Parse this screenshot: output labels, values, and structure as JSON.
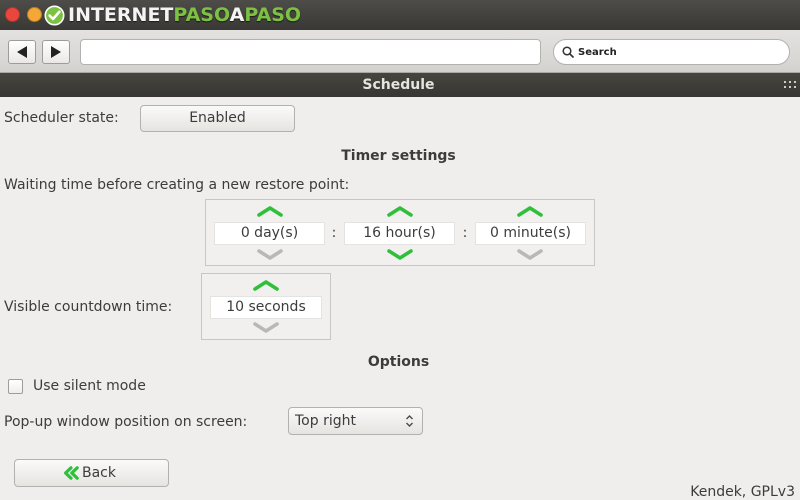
{
  "colors": {
    "accent_green": "#2fbf3a",
    "disabled_gray": "#b8b8b8",
    "titlebar": "#373633",
    "titlebar_light": "#46453f",
    "text": "#3c3c3c",
    "window_bg": "#efeeec",
    "close_button": "#e9473d",
    "minimize_button": "#f4a737",
    "logo_green": "#7dc142"
  },
  "browser": {
    "logo": {
      "icon": "check-circle-icon",
      "parts": [
        "INTERNET",
        "PASO",
        "A",
        "PASO"
      ]
    },
    "nav": {
      "back_icon": "triangle-left-icon",
      "forward_icon": "triangle-right-icon"
    },
    "address": {
      "value": ""
    },
    "search": {
      "icon": "search-icon",
      "placeholder": "Search"
    }
  },
  "window": {
    "title": "Schedule",
    "grip_icon": "grip-icon"
  },
  "scheduler": {
    "state_label": "Scheduler state:",
    "state_button": "Enabled"
  },
  "timer": {
    "heading": "Timer settings",
    "waiting_label": "Waiting time before creating a new restore point:",
    "separator": ":",
    "waiting_spinners": [
      {
        "value": "0 day(s)",
        "up_enabled": true,
        "down_enabled": false
      },
      {
        "value": "16 hour(s)",
        "up_enabled": true,
        "down_enabled": true
      },
      {
        "value": "0 minute(s)",
        "up_enabled": true,
        "down_enabled": false
      }
    ],
    "countdown_label": "Visible countdown time:",
    "countdown_spinner": {
      "value": "10 seconds",
      "up_enabled": true,
      "down_enabled": false
    }
  },
  "options": {
    "heading": "Options",
    "silent_mode": {
      "label": "Use silent mode",
      "checked": false
    },
    "popup_position": {
      "label": "Pop-up window position on screen:",
      "selected": "Top right",
      "icon": "updown-arrows-icon"
    }
  },
  "footer": {
    "back_button": {
      "label": "Back",
      "icon": "double-chevron-left-icon"
    },
    "credits": "Kendek, GPLv3"
  }
}
